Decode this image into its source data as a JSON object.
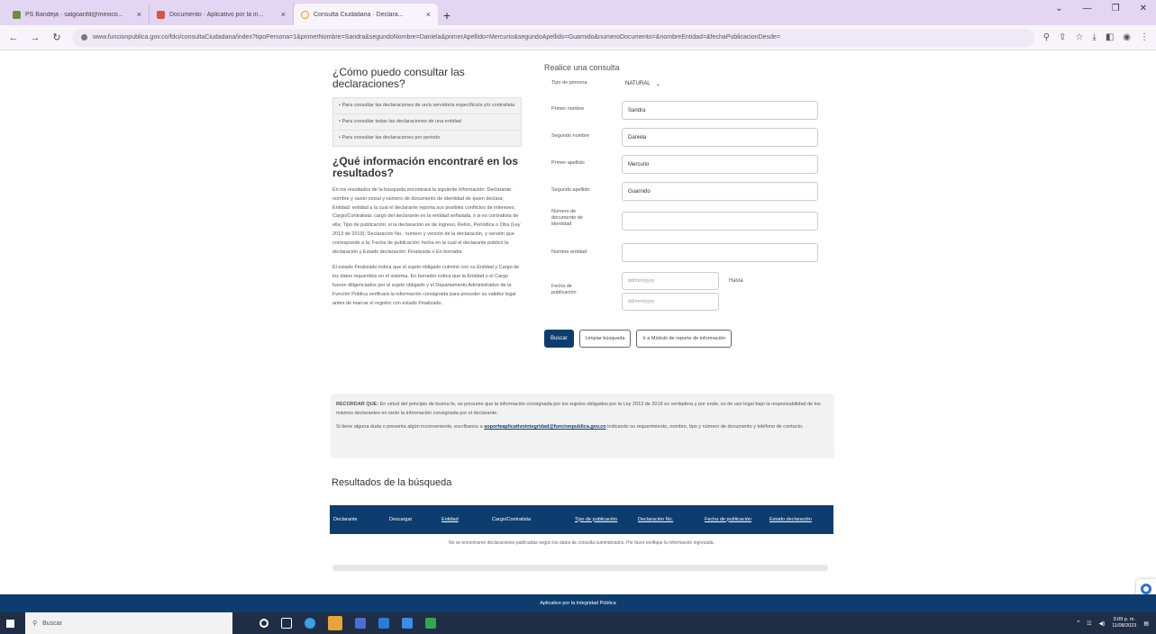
{
  "browser": {
    "tabs": [
      {
        "label": "PS Bandeja · salgoanfd@mexico...",
        "favicon": "mail-icon",
        "active": false
      },
      {
        "label": "Documento · Aplicativo por la in...",
        "favicon": "document-icon",
        "active": false
      },
      {
        "label": "Consulta Ciudadana · Declara...",
        "favicon": "loading-icon",
        "active": true
      }
    ],
    "new_tab": "+",
    "url": "www.funcionpublica.gov.co/fdci/consultaCiudadana/index?tipoPersona=1&primerNombre=Sandra&segundoNombre=Daniela&primerApellido=Mercurio&segundoApellido=Guarnido&numeroDocumento=&nombreEntidad=&fechaPublicacionDesde="
  },
  "left": {
    "how_title": "¿Cómo puedo consultar las declaraciones?",
    "help_items": [
      "• Para consultar las declaraciones de un/a servidor/a específico/a y/o contratista",
      "• Para consultar todas las declaraciones de una entidad",
      "• Para consultar las declaraciones por periodo"
    ],
    "info_title": "¿Qué información encontraré en los resultados?",
    "info_paragraph_1": "En los resultados de la búsqueda encontrará la siguiente información: Declarante: nombre y razón social y número de documento de identidad de quien declara; Entidad: entidad a la cual el declarante reporta sus posibles conflictos de intereses; Cargo/Contratista: cargo del declarante en la entidad señalada, o si es contratista de ella; Tipo de publicación: si la declaración es de ingreso, Retiro, Periódica o Otra (Ley 2013 de 2019); Declaración No.: número y versión de la declaración, y versión que corresponde a la; Fecha de publicación: fecha en la cual el declarante publicó la declaración y Estado declaración: Finalizada o En borrador.",
    "info_paragraph_2": "El estado Finalizado indica que el sujeto obligado culminó con su Entidad y Cargo de los datos requeridos en el sistema. En borrador indica que la Entidad o el Cargo fueron diligenciados por el sujeto obligado y el Departamento Administrativo de la Función Pública verificará la información consignada para proceder su validez legal antes de marcar el registro con estado Finalizado."
  },
  "form": {
    "title": "Realice una consulta",
    "persona_label": "Tipo de persona",
    "persona_value": "NATURAL",
    "primer_nombre_label": "Primer nombre",
    "primer_nombre_value": "Sandra",
    "segundo_nombre_label": "Segundo nombre",
    "segundo_nombre_value": "Daniela",
    "primer_apellido_label": "Primer apellido",
    "primer_apellido_value": "Mercurio",
    "segundo_apellido_label": "Segundo apellido",
    "segundo_apellido_value": "Guarnido",
    "documento_label": "Número de documento de identidad",
    "documento_value": "",
    "entidad_label": "Nombre entidad",
    "entidad_value": "",
    "fecha_label": "Fecha de publicación",
    "fecha_desde_placeholder": "dd/mm/yyyy",
    "fecha_hasta_placeholder": "dd/mm/yyyy",
    "hasta_label": "Hasta",
    "buscar_label": "Buscar",
    "limpiar_label": "Limpiar búsqueda",
    "modulo_label": "Ir a Módulo de reporte de información"
  },
  "notice": {
    "p1_strong": "RECORDAR QUE:",
    "p1": " En virtud del principio de buena fe, se presume que la información consignada por los sujetos obligados por la Ley 2013 de 2019 es verdadera y por ende, es de uso legal bajo la responsabilidad de los mismos declarantes en tanto la información consignada por el declarante.",
    "p2_a": "Si tiene alguna duda o presenta algún inconveniente, escríbanos a ",
    "p2_email": "soporteaplicativointegridad@funcionpublica.gov.co",
    "p2_b": " indicando su requerimiento, nombre, tipo y número de documento y teléfono de contacto."
  },
  "results": {
    "title": "Resultados de la búsqueda",
    "columns": [
      "Declarante",
      "Descargar",
      "Entidad",
      "Cargo/Contratista",
      "Tipo de publicación",
      "Declaración No.",
      "Fecha de publicación",
      "Estado declaración"
    ],
    "empty_message": "No se encontraron declaraciones publicadas según los datos de consulta suministrados. Por favor verifique la información ingresada."
  },
  "footer": {
    "text": "Aplicativo por la Integridad Pública"
  },
  "taskbar": {
    "search_placeholder": "Buscar",
    "time": "3:09 p. m.",
    "date": "11/08/2023"
  }
}
